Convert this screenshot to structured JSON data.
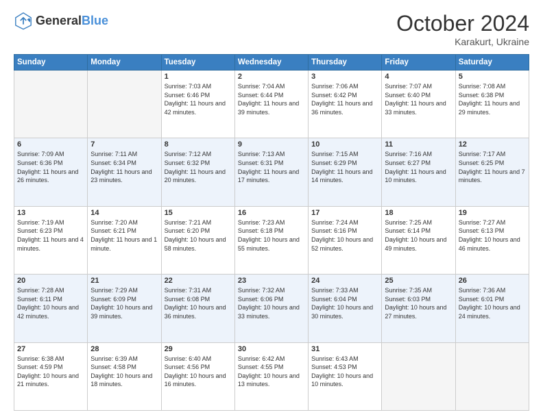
{
  "header": {
    "logo_general": "General",
    "logo_blue": "Blue",
    "month_title": "October 2024",
    "location": "Karakurt, Ukraine"
  },
  "days_of_week": [
    "Sunday",
    "Monday",
    "Tuesday",
    "Wednesday",
    "Thursday",
    "Friday",
    "Saturday"
  ],
  "weeks": [
    [
      {
        "day": "",
        "sunrise": "",
        "sunset": "",
        "daylight": "",
        "empty": true
      },
      {
        "day": "",
        "sunrise": "",
        "sunset": "",
        "daylight": "",
        "empty": true
      },
      {
        "day": "1",
        "sunrise": "Sunrise: 7:03 AM",
        "sunset": "Sunset: 6:46 PM",
        "daylight": "Daylight: 11 hours and 42 minutes.",
        "empty": false
      },
      {
        "day": "2",
        "sunrise": "Sunrise: 7:04 AM",
        "sunset": "Sunset: 6:44 PM",
        "daylight": "Daylight: 11 hours and 39 minutes.",
        "empty": false
      },
      {
        "day": "3",
        "sunrise": "Sunrise: 7:06 AM",
        "sunset": "Sunset: 6:42 PM",
        "daylight": "Daylight: 11 hours and 36 minutes.",
        "empty": false
      },
      {
        "day": "4",
        "sunrise": "Sunrise: 7:07 AM",
        "sunset": "Sunset: 6:40 PM",
        "daylight": "Daylight: 11 hours and 33 minutes.",
        "empty": false
      },
      {
        "day": "5",
        "sunrise": "Sunrise: 7:08 AM",
        "sunset": "Sunset: 6:38 PM",
        "daylight": "Daylight: 11 hours and 29 minutes.",
        "empty": false
      }
    ],
    [
      {
        "day": "6",
        "sunrise": "Sunrise: 7:09 AM",
        "sunset": "Sunset: 6:36 PM",
        "daylight": "Daylight: 11 hours and 26 minutes.",
        "empty": false
      },
      {
        "day": "7",
        "sunrise": "Sunrise: 7:11 AM",
        "sunset": "Sunset: 6:34 PM",
        "daylight": "Daylight: 11 hours and 23 minutes.",
        "empty": false
      },
      {
        "day": "8",
        "sunrise": "Sunrise: 7:12 AM",
        "sunset": "Sunset: 6:32 PM",
        "daylight": "Daylight: 11 hours and 20 minutes.",
        "empty": false
      },
      {
        "day": "9",
        "sunrise": "Sunrise: 7:13 AM",
        "sunset": "Sunset: 6:31 PM",
        "daylight": "Daylight: 11 hours and 17 minutes.",
        "empty": false
      },
      {
        "day": "10",
        "sunrise": "Sunrise: 7:15 AM",
        "sunset": "Sunset: 6:29 PM",
        "daylight": "Daylight: 11 hours and 14 minutes.",
        "empty": false
      },
      {
        "day": "11",
        "sunrise": "Sunrise: 7:16 AM",
        "sunset": "Sunset: 6:27 PM",
        "daylight": "Daylight: 11 hours and 10 minutes.",
        "empty": false
      },
      {
        "day": "12",
        "sunrise": "Sunrise: 7:17 AM",
        "sunset": "Sunset: 6:25 PM",
        "daylight": "Daylight: 11 hours and 7 minutes.",
        "empty": false
      }
    ],
    [
      {
        "day": "13",
        "sunrise": "Sunrise: 7:19 AM",
        "sunset": "Sunset: 6:23 PM",
        "daylight": "Daylight: 11 hours and 4 minutes.",
        "empty": false
      },
      {
        "day": "14",
        "sunrise": "Sunrise: 7:20 AM",
        "sunset": "Sunset: 6:21 PM",
        "daylight": "Daylight: 11 hours and 1 minute.",
        "empty": false
      },
      {
        "day": "15",
        "sunrise": "Sunrise: 7:21 AM",
        "sunset": "Sunset: 6:20 PM",
        "daylight": "Daylight: 10 hours and 58 minutes.",
        "empty": false
      },
      {
        "day": "16",
        "sunrise": "Sunrise: 7:23 AM",
        "sunset": "Sunset: 6:18 PM",
        "daylight": "Daylight: 10 hours and 55 minutes.",
        "empty": false
      },
      {
        "day": "17",
        "sunrise": "Sunrise: 7:24 AM",
        "sunset": "Sunset: 6:16 PM",
        "daylight": "Daylight: 10 hours and 52 minutes.",
        "empty": false
      },
      {
        "day": "18",
        "sunrise": "Sunrise: 7:25 AM",
        "sunset": "Sunset: 6:14 PM",
        "daylight": "Daylight: 10 hours and 49 minutes.",
        "empty": false
      },
      {
        "day": "19",
        "sunrise": "Sunrise: 7:27 AM",
        "sunset": "Sunset: 6:13 PM",
        "daylight": "Daylight: 10 hours and 46 minutes.",
        "empty": false
      }
    ],
    [
      {
        "day": "20",
        "sunrise": "Sunrise: 7:28 AM",
        "sunset": "Sunset: 6:11 PM",
        "daylight": "Daylight: 10 hours and 42 minutes.",
        "empty": false
      },
      {
        "day": "21",
        "sunrise": "Sunrise: 7:29 AM",
        "sunset": "Sunset: 6:09 PM",
        "daylight": "Daylight: 10 hours and 39 minutes.",
        "empty": false
      },
      {
        "day": "22",
        "sunrise": "Sunrise: 7:31 AM",
        "sunset": "Sunset: 6:08 PM",
        "daylight": "Daylight: 10 hours and 36 minutes.",
        "empty": false
      },
      {
        "day": "23",
        "sunrise": "Sunrise: 7:32 AM",
        "sunset": "Sunset: 6:06 PM",
        "daylight": "Daylight: 10 hours and 33 minutes.",
        "empty": false
      },
      {
        "day": "24",
        "sunrise": "Sunrise: 7:33 AM",
        "sunset": "Sunset: 6:04 PM",
        "daylight": "Daylight: 10 hours and 30 minutes.",
        "empty": false
      },
      {
        "day": "25",
        "sunrise": "Sunrise: 7:35 AM",
        "sunset": "Sunset: 6:03 PM",
        "daylight": "Daylight: 10 hours and 27 minutes.",
        "empty": false
      },
      {
        "day": "26",
        "sunrise": "Sunrise: 7:36 AM",
        "sunset": "Sunset: 6:01 PM",
        "daylight": "Daylight: 10 hours and 24 minutes.",
        "empty": false
      }
    ],
    [
      {
        "day": "27",
        "sunrise": "Sunrise: 6:38 AM",
        "sunset": "Sunset: 4:59 PM",
        "daylight": "Daylight: 10 hours and 21 minutes.",
        "empty": false
      },
      {
        "day": "28",
        "sunrise": "Sunrise: 6:39 AM",
        "sunset": "Sunset: 4:58 PM",
        "daylight": "Daylight: 10 hours and 18 minutes.",
        "empty": false
      },
      {
        "day": "29",
        "sunrise": "Sunrise: 6:40 AM",
        "sunset": "Sunset: 4:56 PM",
        "daylight": "Daylight: 10 hours and 16 minutes.",
        "empty": false
      },
      {
        "day": "30",
        "sunrise": "Sunrise: 6:42 AM",
        "sunset": "Sunset: 4:55 PM",
        "daylight": "Daylight: 10 hours and 13 minutes.",
        "empty": false
      },
      {
        "day": "31",
        "sunrise": "Sunrise: 6:43 AM",
        "sunset": "Sunset: 4:53 PM",
        "daylight": "Daylight: 10 hours and 10 minutes.",
        "empty": false
      },
      {
        "day": "",
        "sunrise": "",
        "sunset": "",
        "daylight": "",
        "empty": true
      },
      {
        "day": "",
        "sunrise": "",
        "sunset": "",
        "daylight": "",
        "empty": true
      }
    ]
  ]
}
